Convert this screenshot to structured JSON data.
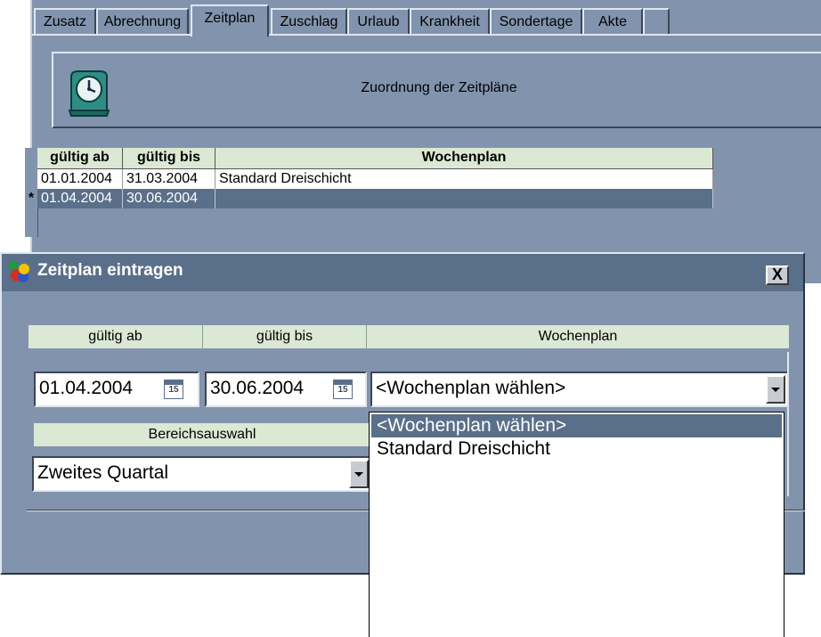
{
  "tabs": [
    {
      "label": "Zusatz",
      "active": false
    },
    {
      "label": "Abrechnung",
      "active": false
    },
    {
      "label": "Zeitplan",
      "active": true
    },
    {
      "label": "Zuschlag",
      "active": false
    },
    {
      "label": "Urlaub",
      "active": false
    },
    {
      "label": "Krankheit",
      "active": false
    },
    {
      "label": "Sondertage",
      "active": false
    },
    {
      "label": "Akte",
      "active": false
    }
  ],
  "panel": {
    "title": "Zuordnung der Zeitpläne",
    "icon": "alarm-clock-icon"
  },
  "grid": {
    "columns": [
      "gültig ab",
      "gültig bis",
      "Wochenplan"
    ],
    "rows": [
      {
        "marker": "",
        "from": "01.01.2004",
        "to": "31.03.2004",
        "plan": "Standard Dreischicht"
      },
      {
        "marker": "*",
        "from": "01.04.2004",
        "to": "30.06.2004",
        "plan": ""
      }
    ]
  },
  "dialog": {
    "title": "Zeitplan eintragen",
    "close_label": "X",
    "headers": {
      "from": "gültig ab",
      "to": "gültig bis",
      "plan": "Wochenplan",
      "area": "Bereichsauswahl"
    },
    "from_value": "01.04.2004",
    "to_value": "30.06.2004",
    "cal_label": "15",
    "plan_value": "<Wochenplan wählen>",
    "area_value": "Zweites Quartal",
    "plan_options": [
      "<Wochenplan wählen>",
      "Standard Dreischicht"
    ]
  },
  "colors": {
    "window_bg": "#8294ad",
    "header_bg": "#dbe8d3",
    "selection": "#5a6f89"
  }
}
